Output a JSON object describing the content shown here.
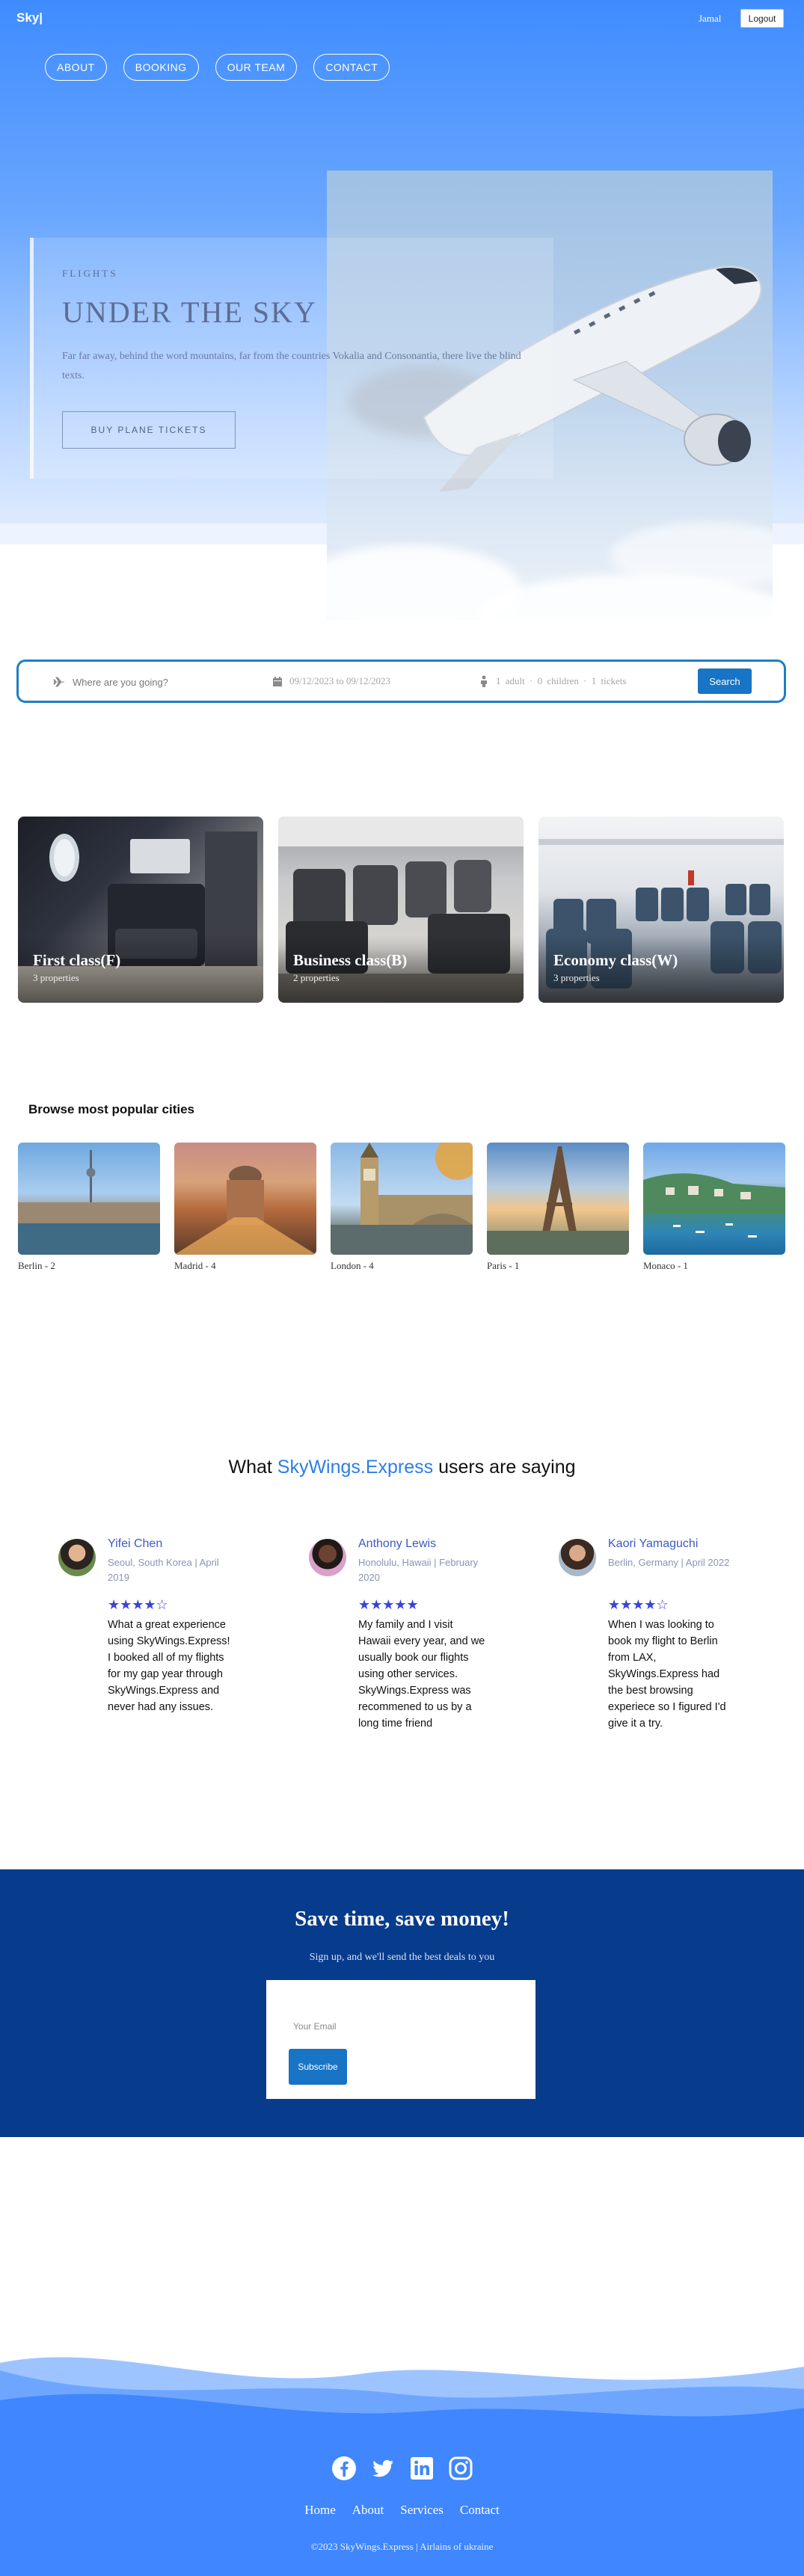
{
  "header": {
    "brand": "Sky|",
    "user_name": "Jamal",
    "logout_label": "Logout",
    "nav": [
      "ABOUT",
      "BOOKING",
      "OUR TEAM",
      "CONTACT"
    ]
  },
  "hero": {
    "kicker": "FLIGHTS",
    "title": "UNDER THE SKY",
    "text": "Far far away, behind the word mountains, far from the countries Vokalia and Consonantia, there live the blind texts.",
    "button": "BUY PLANE TICKETS"
  },
  "search": {
    "destination_placeholder": "Where are you going?",
    "dates": "09/12/2023 to 09/12/2023",
    "guests": "1 adult · 0 children · 1 tickets",
    "button": "Search"
  },
  "classes": [
    {
      "name": "First class(F)",
      "count": "3 properties"
    },
    {
      "name": "Business class(B)",
      "count": "2 properties"
    },
    {
      "name": "Economy class(W)",
      "count": "3 properties"
    }
  ],
  "cities": {
    "title": "Browse most popular cities",
    "items": [
      {
        "label": "Berlin - 2"
      },
      {
        "label": "Madrid - 4"
      },
      {
        "label": "London - 4"
      },
      {
        "label": "Paris - 1"
      },
      {
        "label": "Monaco - 1"
      }
    ]
  },
  "testimonials": {
    "title_before": "What ",
    "title_accent": "SkyWings.Express",
    "title_after": " users are saying",
    "items": [
      {
        "name": "Yifei Chen",
        "meta": "Seoul, South Korea | April 2019",
        "stars": 4,
        "rating": "★★★★☆",
        "text": "What a great experience using SkyWings.Express! I booked all of my flights for my gap year through SkyWings.Express and never had any issues."
      },
      {
        "name": "Anthony Lewis",
        "meta": "Honolulu, Hawaii | February 2020",
        "stars": 5,
        "rating": "★★★★★",
        "text": "My family and I visit Hawaii every year, and we usually book our flights using other services. SkyWings.Express was recommened to us by a long time friend"
      },
      {
        "name": "Kaori Yamaguchi",
        "meta": "Berlin, Germany | April 2022",
        "stars": 4,
        "rating": "★★★★☆",
        "text": "When I was looking to book my flight to Berlin from LAX, SkyWings.Express had the best browsing experiece so I figured I'd give it a try."
      }
    ]
  },
  "newsletter": {
    "title": "Save time, save money!",
    "subtitle": "Sign up, and we'll send the best deals to you",
    "email_placeholder": "Your Email",
    "button": "Subscribe"
  },
  "footer": {
    "social_icons": [
      "facebook-icon",
      "twitter-icon",
      "linkedin-icon",
      "instagram-icon"
    ],
    "links": [
      "Home",
      "About",
      "Services",
      "Contact"
    ],
    "copyright": "©2023 SkyWings.Express | Airlains of ukraine"
  },
  "colors": {
    "hero_blue": "#3f8cff",
    "accent": "#2d7ee6",
    "button_blue": "#1874c4",
    "newsletter_bg": "#073b8c",
    "star": "#3a43d9"
  }
}
